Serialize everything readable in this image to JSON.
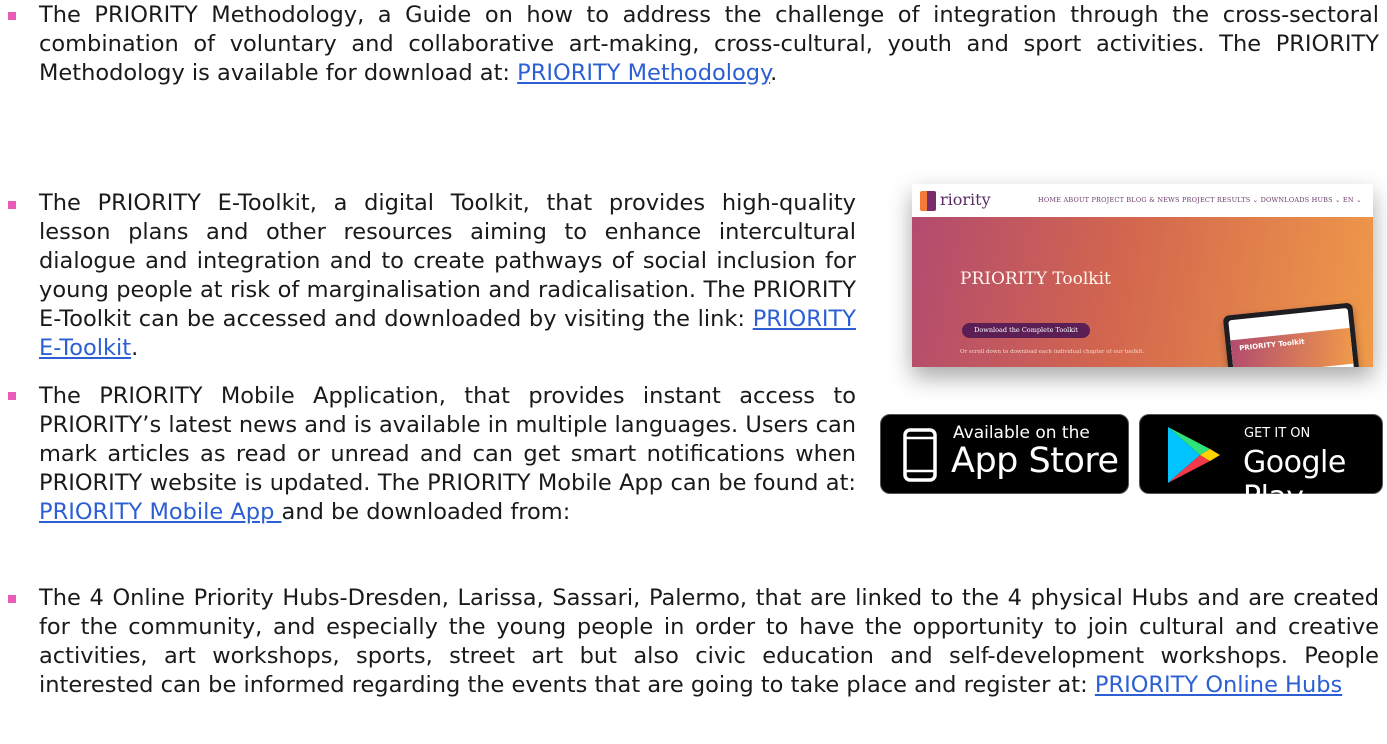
{
  "items": [
    {
      "text": "The PRIORITY Methodology, a Guide on how to address the challenge of integration through the cross-sectoral combination of voluntary and collaborative art-making, cross-cultural, youth and sport activities. The PRIORITY Methodology is available for download at: ",
      "link": "PRIORITY Methodology",
      "after": "."
    },
    {
      "text": "The PRIORITY E-Toolkit, a digital Toolkit, that provides high-quality lesson plans and other resources aiming to enhance intercultural dialogue and integration and to create pathways of social inclusion for young people at risk of marginalisation and radicalisation. The PRIORITY E-Toolkit can be accessed and downloaded by visiting the link: ",
      "link": "PRIORITY E-Toolkit",
      "after": "."
    },
    {
      "text": "The PRIORITY Mobile Application, that provides instant access to PRIORITY’s latest news and is available in multiple languages. Users can mark articles as read or unread and can get smart notifications when PRIORITY website is updated. The PRIORITY Mobile App can be found at: ",
      "link": "PRIORITY Mobile App ",
      "after": "and be downloaded from:"
    },
    {
      "text": "The 4 Online Priority Hubs-Dresden, Larissa, Sassari, Palermo, that are linked to the 4 physical Hubs and are created for the community, and especially the young people in order to have the opportunity to join cultural and creative activities, art workshops, sports, street art but also civic education and self-development workshops. People interested can be informed regarding the events that are going to take place and register at: ",
      "link": "PRIORITY Online Hubs",
      "after": ""
    }
  ],
  "screenshot": {
    "logo": "riority",
    "menu": "HOME   ABOUT PROJECT   BLOG & NEWS   PROJECT RESULTS ⌄   DOWNLOADS   HUBS ⌄   EN ⌄",
    "hero_title": "PRIORITY Toolkit",
    "button": "Download the Complete Toolkit",
    "note": "Or scroll down to download each individual chapter of our toolkit.",
    "tablet_title": "PRIORITY Toolkit"
  },
  "badges": {
    "appstore_small": "Available on the",
    "appstore_big": "App Store",
    "googleplay_small": "GET IT ON",
    "googleplay_big": "Google Play"
  },
  "colors": {
    "bullet": "#e85bb8",
    "link": "#2c5fd4"
  }
}
